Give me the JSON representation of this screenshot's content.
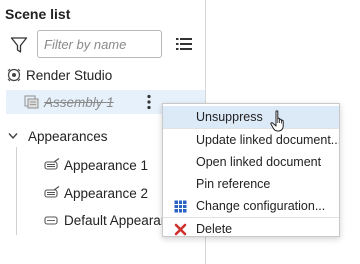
{
  "panel": {
    "title": "Scene list",
    "filter_placeholder": "Filter by name",
    "icons": {
      "filter": "filter-icon",
      "list": "list-view-icon"
    }
  },
  "tree": {
    "render_studio": {
      "label": "Render Studio",
      "icon": "render-studio-icon"
    },
    "assembly": {
      "label": "Assembly 1",
      "suppressed": true,
      "icon": "assembly-icon"
    },
    "appearances": {
      "label": "Appearances",
      "expanded": true,
      "items": [
        {
          "label": "Appearance 1",
          "icon": "appearance-icon"
        },
        {
          "label": "Appearance 2",
          "icon": "appearance-icon"
        },
        {
          "label": "Default Appearan",
          "icon": "appearance-icon"
        }
      ]
    }
  },
  "context_menu": {
    "items": [
      {
        "label": "Unsuppress",
        "hovered": true
      },
      {
        "label": "Update linked document..."
      },
      {
        "label": "Open linked document"
      },
      {
        "label": "Pin reference"
      },
      {
        "label": "Change configuration...",
        "icon": "configuration-table-icon"
      },
      {
        "label": "Delete",
        "icon": "delete-x-icon"
      }
    ]
  },
  "colors": {
    "selected_row": "#e6f1fb",
    "menu_hover": "#dce9f7",
    "config_icon": "#2b63c4",
    "delete_icon": "#d0312d"
  }
}
